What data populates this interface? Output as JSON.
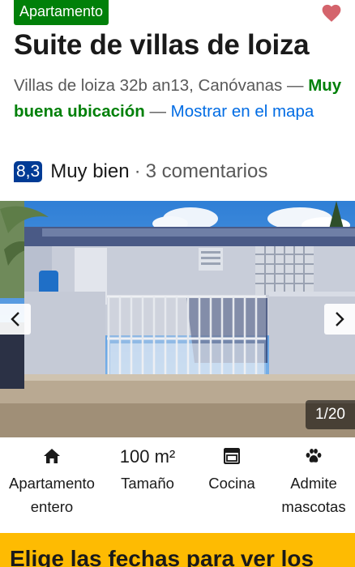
{
  "property": {
    "type_badge": "Apartamento",
    "title": "Suite de villas de loiza",
    "address": "Villas de loiza 32b an13, Canóvanas",
    "separator": "—",
    "location_note": "Muy buena ubicación",
    "map_link": "Mostrar en el mapa",
    "favorite_icon": "heart-icon",
    "accent_color": "#008009",
    "link_color": "#006ce4"
  },
  "rating": {
    "score": "8,3",
    "label": "Muy bien",
    "dot": "·",
    "reviews": "3 comentarios",
    "score_color": "#003b95"
  },
  "gallery": {
    "counter": "1/20",
    "prev_icon": "chevron-left-icon",
    "next_icon": "chevron-right-icon"
  },
  "facilities": [
    {
      "icon": "home-icon",
      "label": "Apartamento entero"
    },
    {
      "value": "100 m²",
      "label": "Tamaño"
    },
    {
      "icon": "stove-icon",
      "label": "Cocina"
    },
    {
      "icon": "paw-icon",
      "label": "Admite mascotas"
    }
  ],
  "cta": {
    "text": "Elige las fechas para ver los",
    "background": "#febb02"
  }
}
